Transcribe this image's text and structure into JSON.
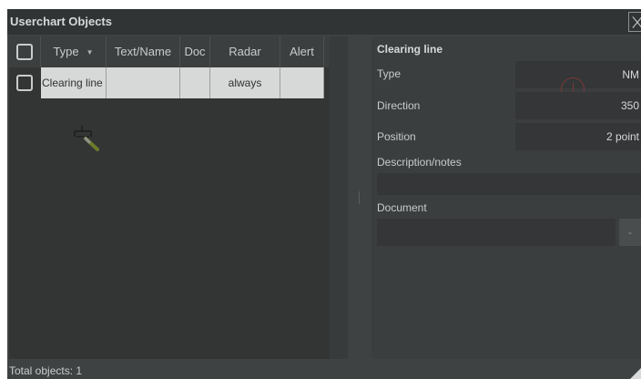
{
  "window": {
    "title": "Userchart Objects"
  },
  "table": {
    "headers": {
      "type": "Type",
      "text_name": "Text/Name",
      "doc": "Doc",
      "radar": "Radar",
      "alert": "Alert"
    },
    "rows": [
      {
        "type": "Clearing line",
        "text_name": "",
        "doc": "",
        "radar": "always",
        "alert": ""
      }
    ]
  },
  "details": {
    "section_title": "Clearing line",
    "type_label": "Type",
    "type_value": "NM",
    "direction_label": "Direction",
    "direction_value": "350",
    "position_label": "Position",
    "position_value": "2 point",
    "description_label": "Description/notes",
    "description_value": "",
    "document_label": "Document",
    "document_value": "",
    "document_button": "-"
  },
  "status": {
    "total_objects": "Total objects: 1"
  },
  "icons": {
    "sort": "sort-arrow-icon",
    "close": "close-icon",
    "symbol": "clearing-line-symbol-icon",
    "warning": "warning-icon",
    "resize": "resize-grip-icon"
  }
}
